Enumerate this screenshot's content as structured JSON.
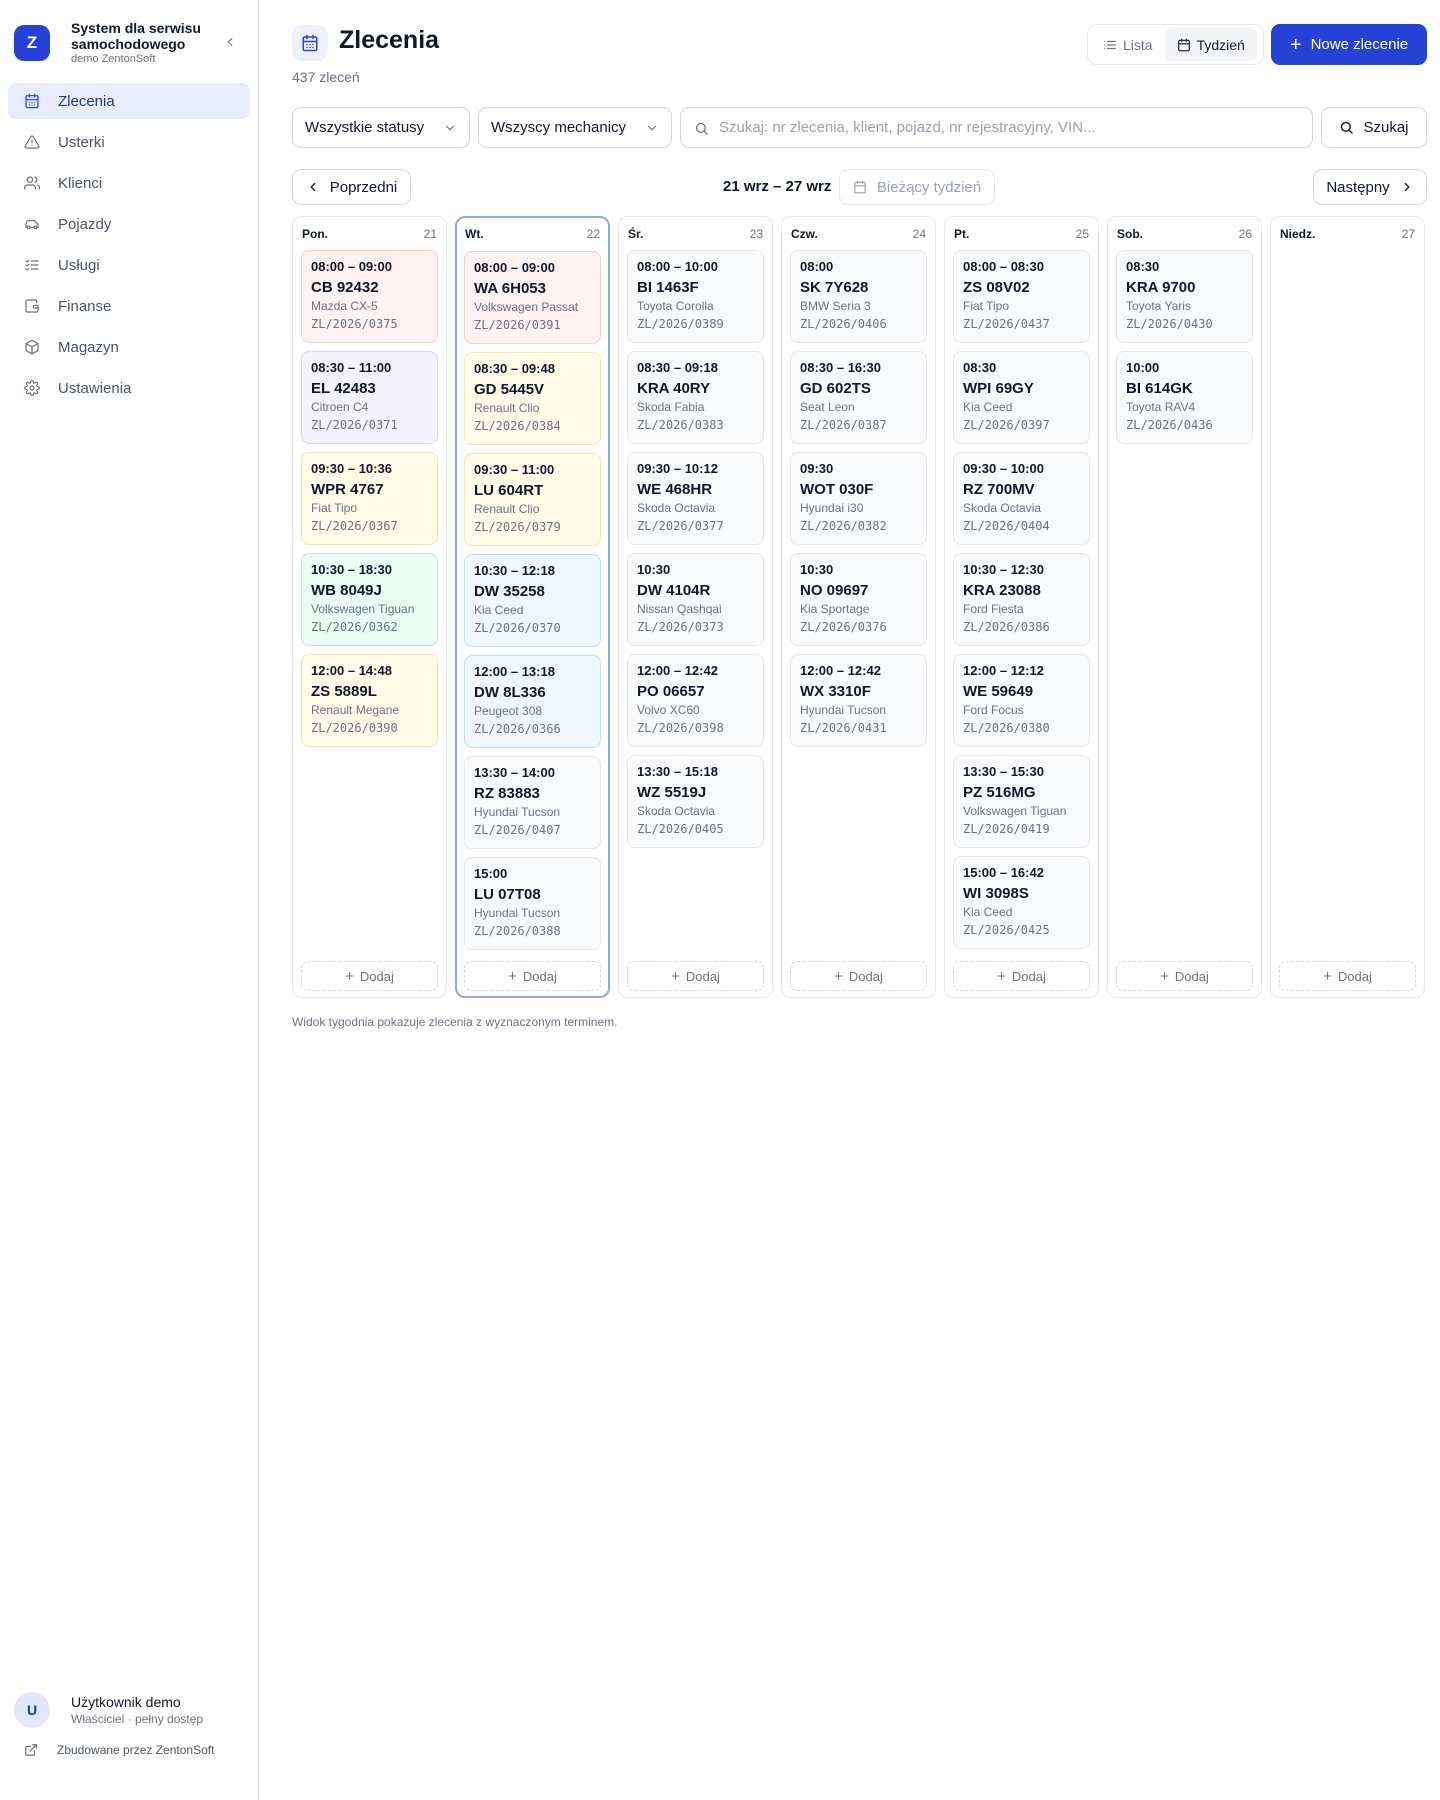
{
  "brand": {
    "logo_letter": "Z",
    "title": "System dla serwisu samochodowego",
    "subtitle": "demo ZentonSoft"
  },
  "sidebar": {
    "items": [
      {
        "label": "Zlecenia",
        "icon": "calendar-icon",
        "active": true
      },
      {
        "label": "Usterki",
        "icon": "warning-icon",
        "active": false
      },
      {
        "label": "Klienci",
        "icon": "users-icon",
        "active": false
      },
      {
        "label": "Pojazdy",
        "icon": "car-icon",
        "active": false
      },
      {
        "label": "Usługi",
        "icon": "list-check-icon",
        "active": false
      },
      {
        "label": "Finanse",
        "icon": "wallet-icon",
        "active": false
      },
      {
        "label": "Magazyn",
        "icon": "package-icon",
        "active": false
      },
      {
        "label": "Ustawienia",
        "icon": "gear-icon",
        "active": false
      }
    ],
    "user": {
      "initial": "U",
      "name": "Użytkownik demo",
      "role": "Właściciel · pełny dostęp"
    },
    "built_by": "Zbudowane przez ZentonSoft"
  },
  "header": {
    "title": "Zlecenia",
    "count": "437 zleceń",
    "view_list": "Lista",
    "view_week": "Tydzień",
    "new_order": "Nowe zlecenie"
  },
  "filters": {
    "status": "Wszystkie statusy",
    "mechanic": "Wszyscy mechanicy",
    "search_placeholder": "Szukaj: nr zlecenia, klient, pojazd, nr rejestracyjny, VIN...",
    "search_button": "Szukaj"
  },
  "week_nav": {
    "prev": "Poprzedni",
    "range": "21 wrz – 27 wrz",
    "current": "Bieżący tydzień",
    "next": "Następny"
  },
  "add_label": "Dodaj",
  "footnote": "Widok tygodnia pokazuje zlecenia z wyznaczonym terminem.",
  "colors": {
    "accent": "#2541d6",
    "today_border": "#95a7dc"
  },
  "days": [
    {
      "name": "Pon.",
      "num": "21",
      "today": false,
      "orders": [
        {
          "time": "08:00 – 09:00",
          "plate": "CB 92432",
          "car": "Mazda CX-5",
          "no": "ZL/2026/0375",
          "color": "red"
        },
        {
          "time": "08:30 – 11:00",
          "plate": "EL 42483",
          "car": "Citroen C4",
          "no": "ZL/2026/0371",
          "color": "purple"
        },
        {
          "time": "09:30 – 10:36",
          "plate": "WPR 4767",
          "car": "Fiat Tipo",
          "no": "ZL/2026/0367",
          "color": "yellow"
        },
        {
          "time": "10:30 – 18:30",
          "plate": "WB 8049J",
          "car": "Volkswagen Tiguan",
          "no": "ZL/2026/0362",
          "color": "green"
        },
        {
          "time": "12:00 – 14:48",
          "plate": "ZS 5889L",
          "car": "Renault Megane",
          "no": "ZL/2026/0390",
          "color": "yellow"
        }
      ]
    },
    {
      "name": "Wt.",
      "num": "22",
      "today": true,
      "orders": [
        {
          "time": "08:00 – 09:00",
          "plate": "WA 6H053",
          "car": "Volkswagen Passat",
          "no": "ZL/2026/0391",
          "color": "red"
        },
        {
          "time": "08:30 – 09:48",
          "plate": "GD 5445V",
          "car": "Renault Clio",
          "no": "ZL/2026/0384",
          "color": "yellow"
        },
        {
          "time": "09:30 – 11:00",
          "plate": "LU 604RT",
          "car": "Renault Clio",
          "no": "ZL/2026/0379",
          "color": "yellow"
        },
        {
          "time": "10:30 – 12:18",
          "plate": "DW 35258",
          "car": "Kia Ceed",
          "no": "ZL/2026/0370",
          "color": "blue"
        },
        {
          "time": "12:00 – 13:18",
          "plate": "DW 8L336",
          "car": "Peugeot 308",
          "no": "ZL/2026/0366",
          "color": "blue"
        },
        {
          "time": "13:30 – 14:00",
          "plate": "RZ 83883",
          "car": "Hyundai Tucson",
          "no": "ZL/2026/0407",
          "color": "gray"
        },
        {
          "time": "15:00",
          "plate": "LU 07T08",
          "car": "Hyundai Tucson",
          "no": "ZL/2026/0388",
          "color": "gray"
        }
      ]
    },
    {
      "name": "Śr.",
      "num": "23",
      "today": false,
      "orders": [
        {
          "time": "08:00 – 10:00",
          "plate": "BI 1463F",
          "car": "Toyota Corolla",
          "no": "ZL/2026/0389",
          "color": "gray"
        },
        {
          "time": "08:30 – 09:18",
          "plate": "KRA 40RY",
          "car": "Skoda Fabia",
          "no": "ZL/2026/0383",
          "color": "gray"
        },
        {
          "time": "09:30 – 10:12",
          "plate": "WE 468HR",
          "car": "Skoda Octavia",
          "no": "ZL/2026/0377",
          "color": "gray"
        },
        {
          "time": "10:30",
          "plate": "DW 4104R",
          "car": "Nissan Qashqai",
          "no": "ZL/2026/0373",
          "color": "gray"
        },
        {
          "time": "12:00 – 12:42",
          "plate": "PO 06657",
          "car": "Volvo XC60",
          "no": "ZL/2026/0398",
          "color": "gray"
        },
        {
          "time": "13:30 – 15:18",
          "plate": "WZ 5519J",
          "car": "Skoda Octavia",
          "no": "ZL/2026/0405",
          "color": "gray"
        }
      ]
    },
    {
      "name": "Czw.",
      "num": "24",
      "today": false,
      "orders": [
        {
          "time": "08:00",
          "plate": "SK 7Y628",
          "car": "BMW Seria 3",
          "no": "ZL/2026/0406",
          "color": "gray"
        },
        {
          "time": "08:30 – 16:30",
          "plate": "GD 602TS",
          "car": "Seat Leon",
          "no": "ZL/2026/0387",
          "color": "gray"
        },
        {
          "time": "09:30",
          "plate": "WOT 030F",
          "car": "Hyundai i30",
          "no": "ZL/2026/0382",
          "color": "gray"
        },
        {
          "time": "10:30",
          "plate": "NO 09697",
          "car": "Kia Sportage",
          "no": "ZL/2026/0376",
          "color": "gray"
        },
        {
          "time": "12:00 – 12:42",
          "plate": "WX 3310F",
          "car": "Hyundai Tucson",
          "no": "ZL/2026/0431",
          "color": "gray"
        }
      ]
    },
    {
      "name": "Pt.",
      "num": "25",
      "today": false,
      "orders": [
        {
          "time": "08:00 – 08:30",
          "plate": "ZS 08V02",
          "car": "Fiat Tipo",
          "no": "ZL/2026/0437",
          "color": "gray"
        },
        {
          "time": "08:30",
          "plate": "WPI 69GY",
          "car": "Kia Ceed",
          "no": "ZL/2026/0397",
          "color": "gray"
        },
        {
          "time": "09:30 – 10:00",
          "plate": "RZ 700MV",
          "car": "Skoda Octavia",
          "no": "ZL/2026/0404",
          "color": "gray"
        },
        {
          "time": "10:30 – 12:30",
          "plate": "KRA 23088",
          "car": "Ford Fiesta",
          "no": "ZL/2026/0386",
          "color": "gray"
        },
        {
          "time": "12:00 – 12:12",
          "plate": "WE 59649",
          "car": "Ford Focus",
          "no": "ZL/2026/0380",
          "color": "gray"
        },
        {
          "time": "13:30 – 15:30",
          "plate": "PZ 516MG",
          "car": "Volkswagen Tiguan",
          "no": "ZL/2026/0419",
          "color": "gray"
        },
        {
          "time": "15:00 – 16:42",
          "plate": "WI 3098S",
          "car": "Kia Ceed",
          "no": "ZL/2026/0425",
          "color": "gray"
        }
      ]
    },
    {
      "name": "Sob.",
      "num": "26",
      "today": false,
      "orders": [
        {
          "time": "08:30",
          "plate": "KRA 9700",
          "car": "Toyota Yaris",
          "no": "ZL/2026/0430",
          "color": "gray"
        },
        {
          "time": "10:00",
          "plate": "BI 614GK",
          "car": "Toyota RAV4",
          "no": "ZL/2026/0436",
          "color": "gray"
        }
      ]
    },
    {
      "name": "Niedz.",
      "num": "27",
      "today": false,
      "orders": []
    }
  ]
}
